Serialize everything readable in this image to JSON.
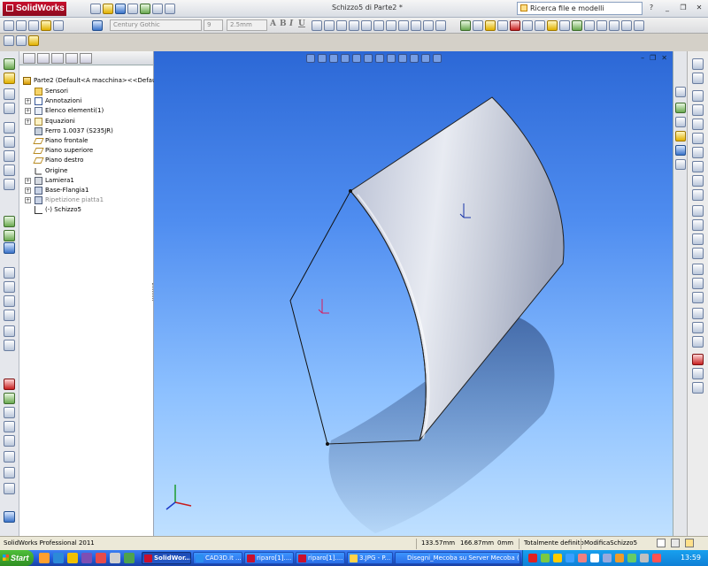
{
  "app": {
    "name": "SolidWorks",
    "doc_title": "Schizzo5 di Parte2 *",
    "search_placeholder": "Ricerca file e modelli"
  },
  "format_bar": {
    "font": "Century Gothic",
    "size": "9",
    "line_height": "2.5mm",
    "format_letters": [
      "A",
      "B",
      "I",
      "U"
    ]
  },
  "feature_tree": {
    "root": "Parte2  (Default<A macchina><<Default>_",
    "items": [
      {
        "label": "Sensori",
        "icon": "folder-icon",
        "expand": ""
      },
      {
        "label": "Annotazioni",
        "icon": "annotation-icon",
        "expand": "+"
      },
      {
        "label": "Elenco elementi(1)",
        "icon": "list-icon",
        "expand": "+"
      },
      {
        "label": "Equazioni",
        "icon": "equation-icon",
        "expand": "+"
      },
      {
        "label": "Ferro 1.0037 (S235JR)",
        "icon": "material-icon",
        "expand": ""
      },
      {
        "label": "Piano frontale",
        "icon": "plane-icon",
        "expand": ""
      },
      {
        "label": "Piano superiore",
        "icon": "plane-icon",
        "expand": ""
      },
      {
        "label": "Piano destro",
        "icon": "plane-icon",
        "expand": ""
      },
      {
        "label": "Origine",
        "icon": "origin-icon",
        "expand": ""
      },
      {
        "label": "Lamiera1",
        "icon": "sheet-metal-icon",
        "expand": "+"
      },
      {
        "label": "Base-Flangia1",
        "icon": "flange-icon",
        "expand": "+"
      },
      {
        "label": "Ripetizione piatta1",
        "icon": "flat-pattern-icon",
        "expand": "+"
      },
      {
        "label": "(-) Schizzo5",
        "icon": "sketch-icon",
        "expand": ""
      }
    ]
  },
  "status_bar": {
    "product": "SolidWorks Professional 2011",
    "x": "133.57mm",
    "y": "166.87mm",
    "z": "0mm",
    "state": "Totalmente definito",
    "mode": "ModificaSchizzo5"
  },
  "taskbar": {
    "start": "Start",
    "tasks": [
      "SolidWor...",
      "CAD3D.it ...",
      "riparo[1]....",
      "riparo[1]....",
      "3.JPG - P...",
      "Disegni_Mecoba su Server Mecoba (Server"
    ],
    "clock": "13:59"
  },
  "colors": {
    "viewport_top": "#2c68d6",
    "viewport_bottom": "#bfe0ff",
    "brand": "#c8102e",
    "taskbar": "#245edb"
  }
}
